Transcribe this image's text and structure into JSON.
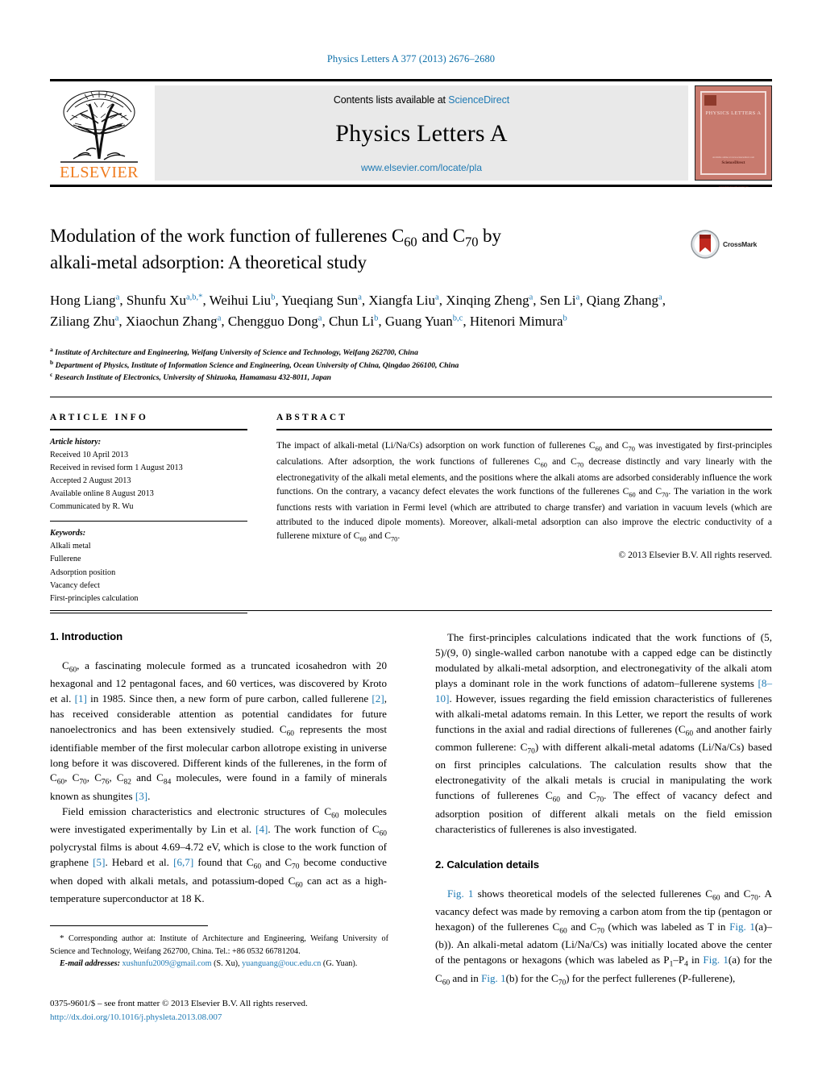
{
  "running_head": "Physics Letters A 377 (2013) 2676–2680",
  "masthead": {
    "contents_prefix": "Contents lists available at ",
    "sciencedirect": "ScienceDirect",
    "journal_name": "Physics Letters A",
    "journal_url": "www.elsevier.com/locate/pla",
    "publisher": "ELSEVIER",
    "cover": {
      "title": "PHYSICS LETTERS A",
      "footer_small": "Available online at www.sciencedirect.com",
      "footer_brand": "ScienceDirect",
      "footer_tiny": "www.elsevier.com/locate/pla"
    }
  },
  "crossmark": {
    "label": "CrossMark"
  },
  "title": {
    "line1_pre": "Modulation of the work function of fullerenes C",
    "line1_sub1": "60",
    "line1_mid": " and C",
    "line1_sub2": "70",
    "line1_post": " by",
    "line2": "alkali-metal adsorption: A theoretical study"
  },
  "authors": {
    "list": [
      {
        "name": "Hong Liang",
        "marks": "a"
      },
      {
        "name": "Shunfu Xu",
        "marks": "a,b,*"
      },
      {
        "name": "Weihui Liu",
        "marks": "b"
      },
      {
        "name": "Yueqiang Sun",
        "marks": "a"
      },
      {
        "name": "Xiangfa Liu",
        "marks": "a"
      },
      {
        "name": "Xinqing Zheng",
        "marks": "a"
      },
      {
        "name": "Sen Li",
        "marks": "a"
      },
      {
        "name": "Qiang Zhang",
        "marks": "a"
      },
      {
        "name": "Ziliang Zhu",
        "marks": "a"
      },
      {
        "name": "Xiaochun Zhang",
        "marks": "a"
      },
      {
        "name": "Chengguo Dong",
        "marks": "a"
      },
      {
        "name": "Chun Li",
        "marks": "b"
      },
      {
        "name": "Guang Yuan",
        "marks": "b,c"
      },
      {
        "name": "Hitenori Mimura",
        "marks": "b"
      }
    ]
  },
  "affiliations": [
    {
      "mark": "a",
      "text": "Institute of Architecture and Engineering, Weifang University of Science and Technology, Weifang 262700, China"
    },
    {
      "mark": "b",
      "text": "Department of Physics, Institute of Information Science and Engineering, Ocean University of China, Qingdao 266100, China"
    },
    {
      "mark": "c",
      "text": "Research Institute of Electronics, University of Shizuoka, Hamamasu 432-8011, Japan"
    }
  ],
  "article_info": {
    "heading": "ARTICLE INFO",
    "history_label": "Article history:",
    "history": [
      "Received 10 April 2013",
      "Received in revised form 1 August 2013",
      "Accepted 2 August 2013",
      "Available online 8 August 2013",
      "Communicated by R. Wu"
    ],
    "keywords_label": "Keywords:",
    "keywords": [
      "Alkali metal",
      "Fullerene",
      "Adsorption position",
      "Vacancy defect",
      "First-principles calculation"
    ]
  },
  "abstract": {
    "heading": "ABSTRACT",
    "text": "The impact of alkali-metal (Li/Na/Cs) adsorption on work function of fullerenes C60 and C70 was investigated by first-principles calculations. After adsorption, the work functions of fullerenes C60 and C70 decrease distinctly and vary linearly with the electronegativity of the alkali metal elements, and the positions where the alkali atoms are adsorbed considerably influence the work functions. On the contrary, a vacancy defect elevates the work functions of the fullerenes C60 and C70. The variation in the work functions rests with variation in Fermi level (which are attributed to charge transfer) and variation in vacuum levels (which are attributed to the induced dipole moments). Moreover, alkali-metal adsorption can also improve the electric conductivity of a fullerene mixture of C60 and C70.",
    "copyright": "© 2013 Elsevier B.V. All rights reserved."
  },
  "sections": {
    "introduction_title": "1. Introduction",
    "calculation_title": "2. Calculation details"
  },
  "body": {
    "intro_p1": "C60, a fascinating molecule formed as a truncated icosahedron with 20 hexagonal and 12 pentagonal faces, and 60 vertices, was discovered by Kroto et al. [1] in 1985. Since then, a new form of pure carbon, called fullerene [2], has received considerable attention as potential candidates for future nanoelectronics and has been extensively studied. C60 represents the most identifiable member of the first molecular carbon allotrope existing in universe long before it was discovered. Different kinds of the fullerenes, in the form of C60, C70, C76, C82 and C84 molecules, were found in a family of minerals known as shungites [3].",
    "intro_p2": "Field emission characteristics and electronic structures of C60 molecules were investigated experimentally by Lin et al. [4]. The work function of C60 polycrystal films is about 4.69–4.72 eV, which is close to the work function of graphene [5]. Hebard et al. [6,7] found that C60 and C70 become conductive when doped with alkali metals, and potassium-doped C60 can act as a high-temperature superconductor at 18 K.",
    "intro_p3": "The first-principles calculations indicated that the work functions of (5, 5)/(9, 0) single-walled carbon nanotube with a capped edge can be distinctly modulated by alkali-metal adsorption, and electronegativity of the alkali atom plays a dominant role in the work functions of adatom–fullerene systems [8–10]. However, issues regarding the field emission characteristics of fullerenes with alkali-metal adatoms remain. In this Letter, we report the results of work functions in the axial and radial directions of fullerenes (C60 and another fairly common fullerene: C70) with different alkali-metal adatoms (Li/Na/Cs) based on first principles calculations. The calculation results show that the electronegativity of the alkali metals is crucial in manipulating the work functions of fullerenes C60 and C70. The effect of vacancy defect and adsorption position of different alkali metals on the field emission characteristics of fullerenes is also investigated.",
    "calc_p1": "Fig. 1 shows theoretical models of the selected fullerenes C60 and C70. A vacancy defect was made by removing a carbon atom from the tip (pentagon or hexagon) of the fullerenes C60 and C70 (which was labeled as T in Fig. 1(a)–(b)). An alkali-metal adatom (Li/Na/Cs) was initially located above the center of the pentagons or hexagons (which was labeled as P1–P4 in Fig. 1(a) for the C60 and in Fig. 1(b) for the C70) for the perfect fullerenes (P-fullerene),"
  },
  "footnote": {
    "corresponding": "Corresponding author at: Institute of Architecture and Engineering, Weifang University of Science and Technology, Weifang 262700, China. Tel.: +86 0532 66781204.",
    "email_label": "E-mail addresses:",
    "email1": "xushunfu2009@gmail.com",
    "email1_owner": "(S. Xu),",
    "email2": "yuanguang@ouc.edu.cn",
    "email2_owner": "(G. Yuan)."
  },
  "imprint": {
    "issn_line": "0375-9601/$ – see front matter © 2013 Elsevier B.V. All rights reserved.",
    "doi": "http://dx.doi.org/10.1016/j.physleta.2013.08.007"
  },
  "colors": {
    "link": "#1f7ab4",
    "running_head": "#0b6ea8",
    "elsevier_orange": "#f07b1d",
    "cover_red": "#c87a6e"
  }
}
